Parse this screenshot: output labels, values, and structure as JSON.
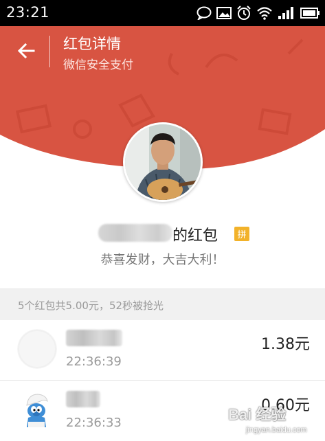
{
  "status_bar": {
    "time": "23:21",
    "icons": [
      "chat-bubble-icon",
      "image-icon",
      "alarm-icon",
      "wifi-icon",
      "signal-icon",
      "battery-icon"
    ]
  },
  "header": {
    "title": "红包详情",
    "subtitle": "微信安全支付",
    "back_icon": "back-arrow-icon",
    "background_color": "#d85442",
    "background_dark": "#c94634"
  },
  "sender": {
    "name_suffix": "的红包",
    "badge": "拼",
    "badge_color": "#f2b22a",
    "greeting": "恭喜发财，大吉大利！"
  },
  "summary": {
    "text": "5个红包共5.00元，52秒被抢光"
  },
  "records": [
    {
      "time": "22:36:39",
      "amount": "1.38元",
      "avatar": "blank-avatar"
    },
    {
      "time": "22:36:33",
      "amount": "0.60元",
      "avatar": "smurf-avatar"
    }
  ],
  "watermark": {
    "logo": "Bai 经验",
    "url": "jingyan.baidu.com"
  }
}
